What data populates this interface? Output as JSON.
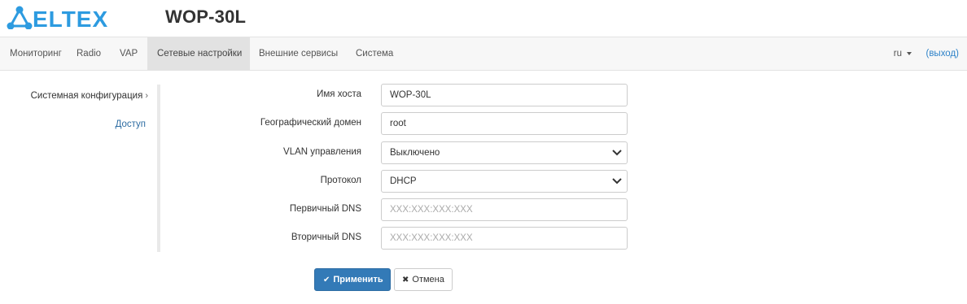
{
  "header": {
    "brand": "ELTEX",
    "model": "WOP-30L",
    "brand_color": "#2d9be0"
  },
  "nav": {
    "items": [
      {
        "label": "Мониторинг",
        "icon": null
      },
      {
        "label": "Radio",
        "icon": null
      },
      {
        "label": "VAP",
        "icon": null
      },
      {
        "label": "Сетевые настройки",
        "active": true
      },
      {
        "label": "Внешние сервисы",
        "icon": null
      },
      {
        "label": "Система",
        "icon": null
      }
    ],
    "lang": "ru",
    "logout": "(выход)"
  },
  "sidebar": {
    "items": [
      {
        "label": "Системная конфигурация",
        "icon": "chevron-right-icon",
        "active": true
      },
      {
        "label": "Доступ"
      }
    ]
  },
  "form": {
    "hostname": {
      "label": "Имя хоста",
      "value": "WOP-30L"
    },
    "domain": {
      "label": "Географический домен",
      "value": "root"
    },
    "vlan": {
      "label": "VLAN управления",
      "value": "Выключено"
    },
    "protocol": {
      "label": "Протокол",
      "value": "DHCP"
    },
    "dns1": {
      "label": "Первичный DNS",
      "value": "",
      "placeholder": "XXX:XXX:XXX:XXX"
    },
    "dns2": {
      "label": "Вторичный DNS",
      "value": "",
      "placeholder": "XXX:XXX:XXX:XXX"
    }
  },
  "buttons": {
    "apply": "Применить",
    "apply_icon": "check-icon",
    "cancel": "Отмена",
    "cancel_icon": "close-icon",
    "primary_color": "#337ab7"
  }
}
